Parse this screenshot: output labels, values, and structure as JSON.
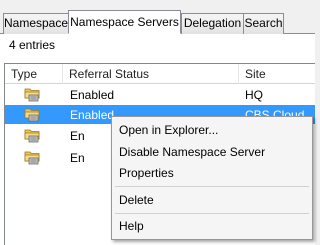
{
  "tabs": [
    {
      "label": "Namespace",
      "active": false
    },
    {
      "label": "Namespace Servers",
      "active": true
    },
    {
      "label": "Delegation",
      "active": false
    },
    {
      "label": "Search",
      "active": false
    }
  ],
  "entries_count": "4 entries",
  "list": {
    "columns": [
      "Type",
      "Referral Status",
      "Site"
    ],
    "rows": [
      {
        "icon": "folder-server-icon",
        "status": "Enabled",
        "site": "HQ"
      },
      {
        "icon": "folder-server-icon",
        "status": "Enabled",
        "site": "CBS Cloud"
      },
      {
        "icon": "folder-server-icon",
        "status": "En",
        "site": ""
      },
      {
        "icon": "folder-server-icon",
        "status": "En",
        "site": ""
      }
    ],
    "selected_row": 1
  },
  "context_menu": {
    "items": [
      "Open in Explorer...",
      "Disable Namespace Server",
      "Properties",
      "Delete",
      "Help"
    ]
  },
  "colors": {
    "selection": "#3399ff",
    "folder": "#e8c65a"
  }
}
